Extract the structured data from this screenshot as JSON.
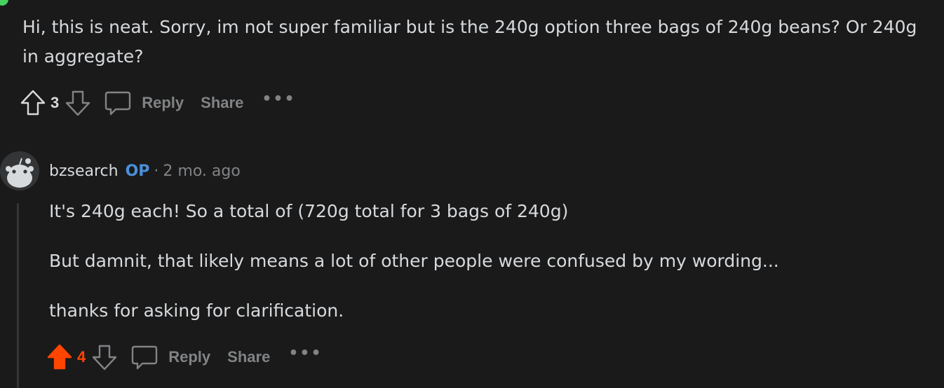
{
  "colors": {
    "background": "#1a1a1b",
    "text": "#d7dadc",
    "muted": "#818384",
    "upvote_active": "#ff4500",
    "op_badge": "#4a90d9",
    "online": "#46d160"
  },
  "parent_comment": {
    "text": "Hi, this is neat. Sorry, im not super familiar but is the 240g option three bags of 240g beans? Or 240g in aggregate?",
    "score": "3",
    "reply_label": "Reply",
    "share_label": "Share",
    "more_label": "•••",
    "icons": [
      "upvote-icon",
      "downvote-icon",
      "comment-icon",
      "more-icon"
    ]
  },
  "reply_comment": {
    "author": "bzsearch",
    "op_badge": "OP",
    "separator": "·",
    "timestamp": "2 mo. ago",
    "paragraphs": [
      "It's 240g each! So a total of (720g total for 3 bags of 240g)",
      "But damnit, that likely means a lot of other people were confused by my wording...",
      "thanks for asking for clarification."
    ],
    "score": "4",
    "upvoted": true,
    "reply_label": "Reply",
    "share_label": "Share",
    "more_label": "•••",
    "icons": [
      "avatar-snoo-icon",
      "upvote-filled-icon",
      "downvote-icon",
      "comment-icon",
      "more-icon"
    ]
  }
}
